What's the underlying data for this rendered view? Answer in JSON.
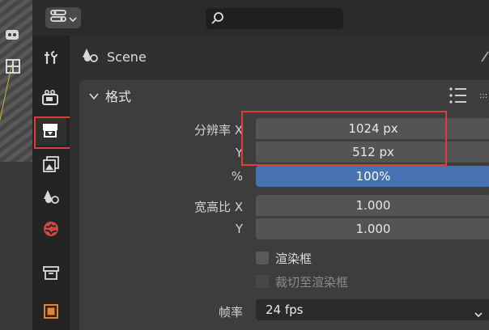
{
  "header": {
    "editor_type_icon": "properties-editor-icon",
    "search_icon": "search-icon"
  },
  "tabs": [
    {
      "name": "tool",
      "icon": "tool-wrench-icon"
    },
    {
      "name": "render",
      "icon": "render-camera-icon"
    },
    {
      "name": "output",
      "icon": "output-printer-icon",
      "active": true
    },
    {
      "name": "view-layer",
      "icon": "view-layer-icon"
    },
    {
      "name": "scene",
      "icon": "scene-icon"
    },
    {
      "name": "world",
      "icon": "world-icon"
    },
    {
      "name": "collection",
      "icon": "collection-box-icon"
    },
    {
      "name": "object",
      "icon": "object-square-icon"
    }
  ],
  "scene": {
    "label": "Scene",
    "icon": "scene-icon"
  },
  "format_panel": {
    "title": "格式",
    "resolution_x_label": "分辨率 X",
    "resolution_y_label": "Y",
    "resolution_x": "1024 px",
    "resolution_y": "512 px",
    "percent_label": "%",
    "percent": "100%",
    "percent_value": 1.0,
    "aspect_x_label": "宽高比 X",
    "aspect_y_label": "Y",
    "aspect_x": "1.000",
    "aspect_y": "1.000",
    "render_region_label": "渲染框",
    "crop_label": "裁切至渲染框",
    "frame_rate_label": "帧率",
    "frame_rate": "24 fps"
  },
  "colors": {
    "accent": "#4772b3",
    "highlight": "#e23b3b",
    "output_tab": "#ffffff",
    "world_tab": "#d24646",
    "object_tab": "#e8822e"
  }
}
